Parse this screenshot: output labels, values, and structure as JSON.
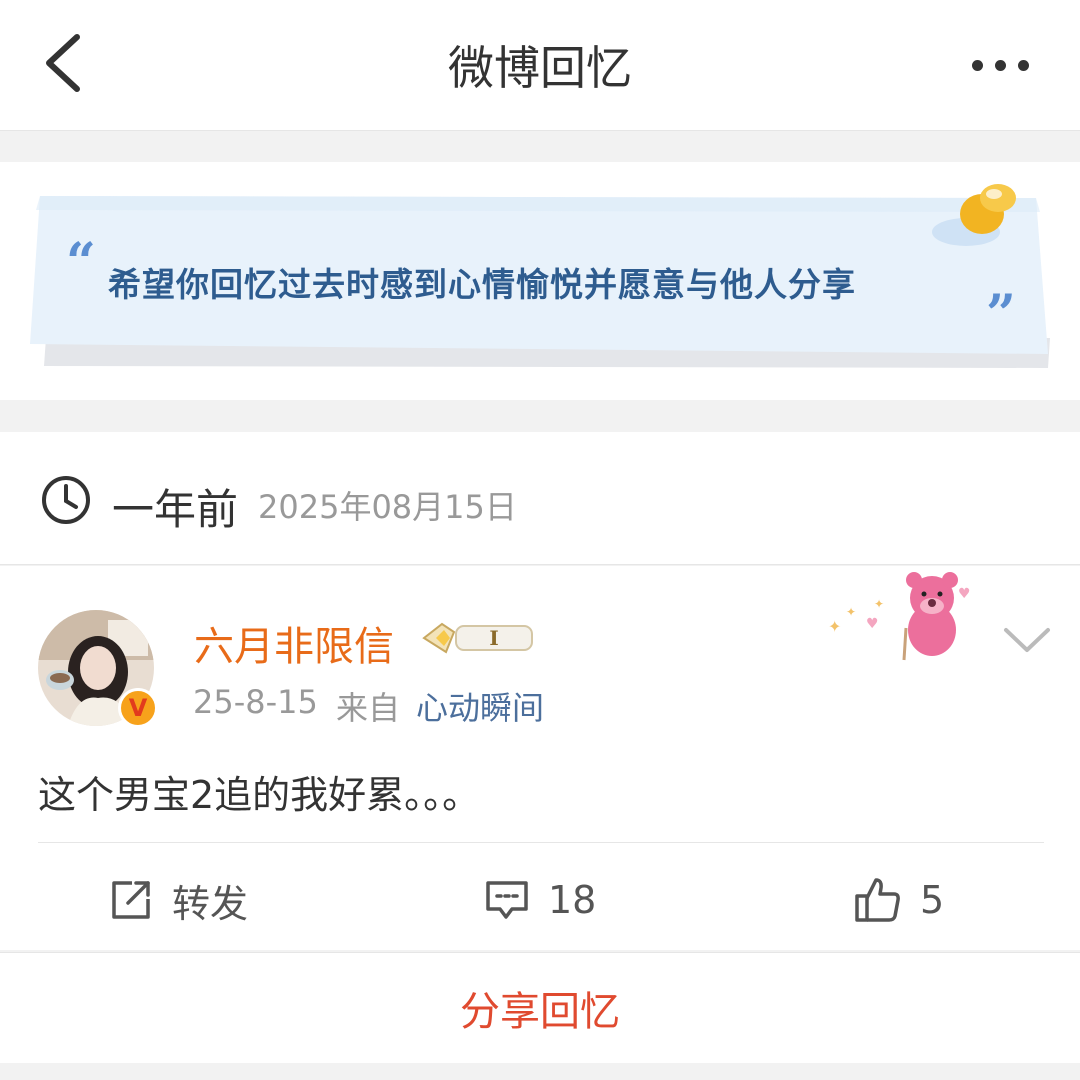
{
  "header": {
    "title": "微博回忆",
    "back_icon": "chevron-left-icon",
    "more_icon": "more-dots-icon"
  },
  "banner": {
    "quote": "希望你回忆过去时感到心情愉悦并愿意与他人分享",
    "open_mark": "“",
    "close_mark": "”",
    "colors": {
      "paper": "#e8f2fb",
      "text": "#2e5c8f",
      "pin": "#f2b422"
    }
  },
  "memory": {
    "ago": "一年前",
    "date": "2025年08月15日"
  },
  "post": {
    "username": "六月非限信",
    "verified_badge": "V",
    "level_badge": "I",
    "date": "25-8-15",
    "from_label": "来自",
    "source": "心动瞬间",
    "text": "这个男宝2追的我好累。。。",
    "actions": {
      "repost": "转发",
      "comments": "18",
      "likes": "5"
    }
  },
  "share": {
    "label": "分享回忆"
  },
  "colors": {
    "username": "#e86b19",
    "share": "#e04a2f",
    "source": "#4c6f9c"
  }
}
